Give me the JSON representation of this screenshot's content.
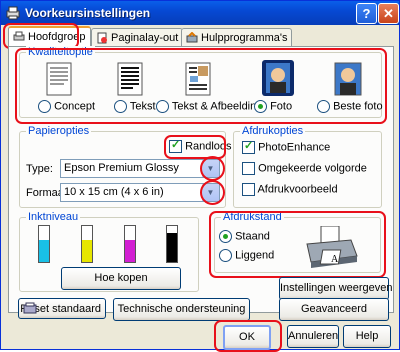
{
  "window": {
    "title": "Voorkeursinstellingen",
    "help": "?",
    "close": "✕"
  },
  "tabs": [
    {
      "label": "Hoofdgroep"
    },
    {
      "label": "Paginalay-out"
    },
    {
      "label": "Hulpprogramma's"
    }
  ],
  "quality": {
    "label": "Kwaliteitoptie",
    "options": [
      {
        "label": "Concept",
        "selected": false
      },
      {
        "label": "Tekst",
        "selected": false
      },
      {
        "label": "Tekst & Afbeelding",
        "selected": false
      },
      {
        "label": "Foto",
        "selected": true
      },
      {
        "label": "Beste foto",
        "selected": false
      }
    ]
  },
  "paper": {
    "label": "Papieropties",
    "borderless_label": "Randloos",
    "borderless_checked": true,
    "type_label": "Type:",
    "type_value": "Epson Premium Glossy",
    "format_label": "Formaat:",
    "format_value": "10 x 15 cm (4 x 6 in)"
  },
  "print_options": {
    "label": "Afdrukopties",
    "items": [
      {
        "label": "PhotoEnhance",
        "checked": true
      },
      {
        "label": "Omgekeerde volgorde",
        "checked": false
      },
      {
        "label": "Afdrukvoorbeeld",
        "checked": false
      }
    ]
  },
  "ink": {
    "label": "Inktniveau",
    "levels": [
      {
        "color": "#19c0e6",
        "level": 0.62
      },
      {
        "color": "#e6e600",
        "level": 0.62
      },
      {
        "color": "#d21fd2",
        "level": 0.62
      },
      {
        "color": "#000000",
        "level": 0.8
      }
    ],
    "buy_label": "Hoe kopen"
  },
  "orientation": {
    "label": "Afdrukstand",
    "options": [
      {
        "label": "Staand",
        "selected": true
      },
      {
        "label": "Liggend",
        "selected": false
      }
    ]
  },
  "buttons": {
    "show_settings": "Instellingen weergeven",
    "advanced": "Geavanceerd",
    "reset": "Reset standaard",
    "support": "Technische ondersteuning",
    "ok": "OK",
    "cancel": "Annuleren",
    "help": "Help"
  },
  "colors": {
    "highlight": "#e8101a",
    "group_label": "#0046d5",
    "titlebar": "#0649d4"
  }
}
